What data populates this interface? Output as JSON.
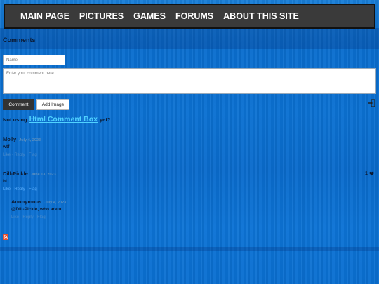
{
  "nav": {
    "items": [
      "MAIN PAGE",
      "PICTURES",
      "GAMES",
      "FORUMS",
      "ABOUT THIS SITE"
    ]
  },
  "comments_section": {
    "title": "Comments",
    "name_placeholder": "Name",
    "comment_placeholder": "Enter your comment here",
    "comment_button": "Comment",
    "add_image_button": "Add Image",
    "promo_prefix": "Not using",
    "promo_brand": "Html Comment Box",
    "promo_suffix": "yet?"
  },
  "comments": [
    {
      "author": "Molly",
      "date": "July 4, 2023",
      "text": "wtf",
      "actions": "Like · Reply · Flag"
    },
    {
      "author": "Dill-Pickle",
      "date": "June 13, 2023",
      "text": "hi",
      "actions": "Like · Reply · Flag",
      "likes": "1"
    },
    {
      "author": "Anonymous",
      "date": "July 4, 2023",
      "text": "@Dill-Pickle, who are u",
      "actions": "Like · Reply · Flag"
    }
  ],
  "colors": {
    "nav_bg": "#3a3a3a",
    "brand": "#4fd2ff",
    "link": "#5fb2ff"
  },
  "icons": {
    "login": "login-icon",
    "like": "heart-icon",
    "rss": "rss-icon"
  }
}
